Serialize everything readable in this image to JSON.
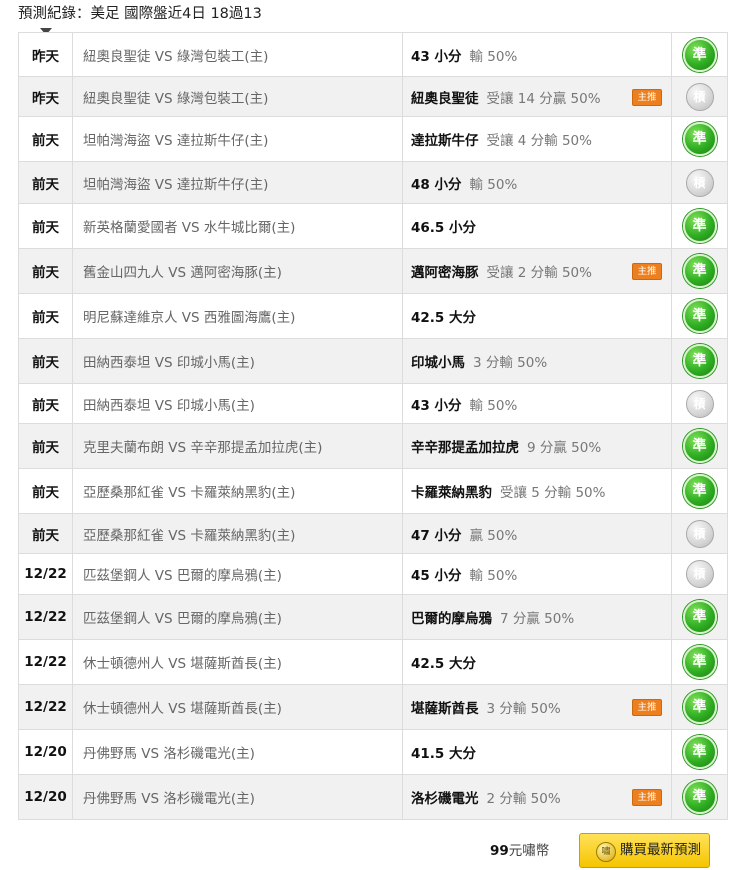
{
  "header": {
    "title": "預測紀錄：美足 國際盤近4日 18過13"
  },
  "records": [
    {
      "day": "昨天",
      "match": "紐奧良聖徒 VS 綠灣包裝工(主)",
      "pick": "43 小分",
      "detail": "輸 50%",
      "tag": "",
      "result": "準",
      "status": "hit"
    },
    {
      "day": "昨天",
      "match": "紐奧良聖徒 VS 綠灣包裝工(主)",
      "pick": "紐奧良聖徒",
      "detail": "受讓 14 分贏 50%",
      "tag": "主推",
      "result": "槓",
      "status": "miss"
    },
    {
      "day": "前天",
      "match": "坦帕灣海盜 VS 達拉斯牛仔(主)",
      "pick": "達拉斯牛仔",
      "detail": "受讓 4 分輸 50%",
      "tag": "",
      "result": "準",
      "status": "hit"
    },
    {
      "day": "前天",
      "match": "坦帕灣海盜 VS 達拉斯牛仔(主)",
      "pick": "48 小分",
      "detail": "輸 50%",
      "tag": "",
      "result": "槓",
      "status": "miss"
    },
    {
      "day": "前天",
      "match": "新英格蘭愛國者 VS 水牛城比爾(主)",
      "pick": "46.5 小分",
      "detail": "",
      "tag": "",
      "result": "準",
      "status": "hit"
    },
    {
      "day": "前天",
      "match": "舊金山四九人 VS 邁阿密海豚(主)",
      "pick": "邁阿密海豚",
      "detail": "受讓 2 分輸 50%",
      "tag": "主推",
      "result": "準",
      "status": "hit"
    },
    {
      "day": "前天",
      "match": "明尼蘇達維京人 VS 西雅圖海鷹(主)",
      "pick": "42.5 大分",
      "detail": "",
      "tag": "",
      "result": "準",
      "status": "hit"
    },
    {
      "day": "前天",
      "match": "田納西泰坦 VS 印城小馬(主)",
      "pick": "印城小馬",
      "detail": "3 分輸 50%",
      "tag": "",
      "result": "準",
      "status": "hit"
    },
    {
      "day": "前天",
      "match": "田納西泰坦 VS 印城小馬(主)",
      "pick": "43 小分",
      "detail": "輸 50%",
      "tag": "",
      "result": "槓",
      "status": "miss"
    },
    {
      "day": "前天",
      "match": "克里夫蘭布朗 VS 辛辛那提孟加拉虎(主)",
      "pick": "辛辛那提孟加拉虎",
      "detail": "9 分贏 50%",
      "tag": "",
      "result": "準",
      "status": "hit"
    },
    {
      "day": "前天",
      "match": "亞歷桑那紅雀 VS 卡羅萊納黑豹(主)",
      "pick": "卡羅萊納黑豹",
      "detail": "受讓 5 分輸 50%",
      "tag": "",
      "result": "準",
      "status": "hit"
    },
    {
      "day": "前天",
      "match": "亞歷桑那紅雀 VS 卡羅萊納黑豹(主)",
      "pick": "47 小分",
      "detail": "贏 50%",
      "tag": "",
      "result": "槓",
      "status": "miss"
    },
    {
      "day": "12/22",
      "match": "匹茲堡鋼人 VS 巴爾的摩烏鴉(主)",
      "pick": "45 小分",
      "detail": "輸 50%",
      "tag": "",
      "result": "槓",
      "status": "miss"
    },
    {
      "day": "12/22",
      "match": "匹茲堡鋼人 VS 巴爾的摩烏鴉(主)",
      "pick": "巴爾的摩烏鴉",
      "detail": "7 分贏 50%",
      "tag": "",
      "result": "準",
      "status": "hit"
    },
    {
      "day": "12/22",
      "match": "休士頓德州人 VS 堪薩斯酋長(主)",
      "pick": "42.5 大分",
      "detail": "",
      "tag": "",
      "result": "準",
      "status": "hit"
    },
    {
      "day": "12/22",
      "match": "休士頓德州人 VS 堪薩斯酋長(主)",
      "pick": "堪薩斯酋長",
      "detail": "3 分輸 50%",
      "tag": "主推",
      "result": "準",
      "status": "hit"
    },
    {
      "day": "12/20",
      "match": "丹佛野馬 VS 洛杉磯電光(主)",
      "pick": "41.5 大分",
      "detail": "",
      "tag": "",
      "result": "準",
      "status": "hit"
    },
    {
      "day": "12/20",
      "match": "丹佛野馬 VS 洛杉磯電光(主)",
      "pick": "洛杉磯電光",
      "detail": "2 分輸 50%",
      "tag": "主推",
      "result": "準",
      "status": "hit"
    }
  ],
  "footer": {
    "price_amount": "99",
    "price_unit": "元嘯幣",
    "buy_label": "購買最新預測",
    "buy_icon_text": "嘯"
  },
  "colors": {
    "hit_green": "#2fae22",
    "miss_gray": "#c9c9c9",
    "tag_orange": "#ee7f1e",
    "buy_yellow": "#f5c400"
  }
}
